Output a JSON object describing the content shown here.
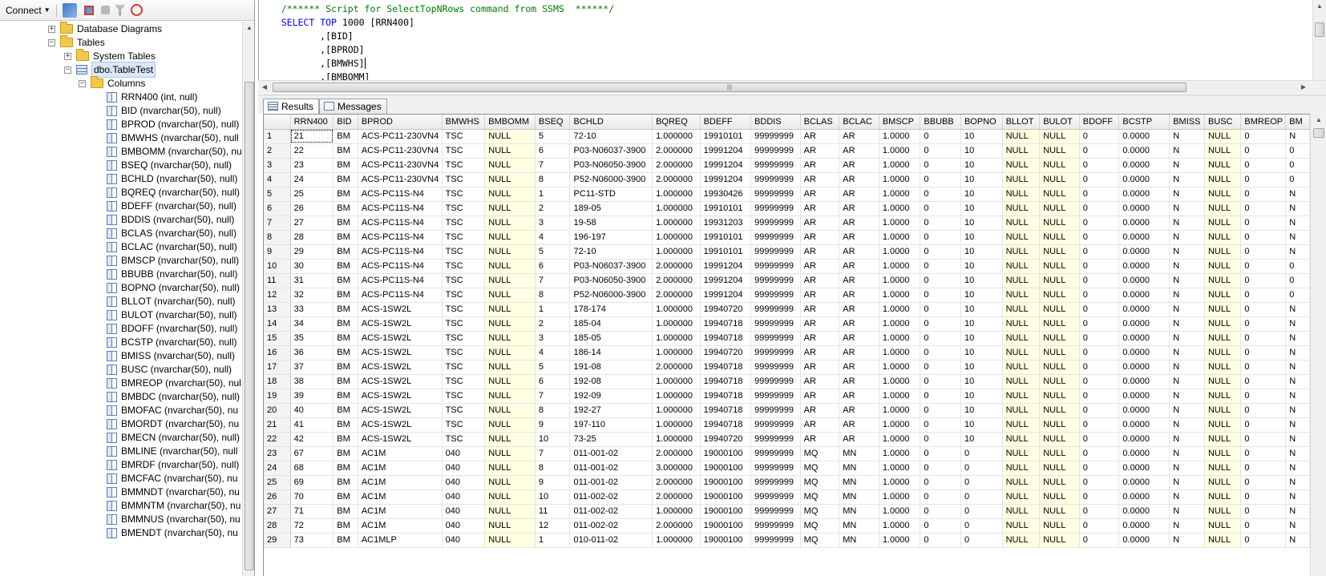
{
  "toolbar": {
    "connect_label": "Connect",
    "icons": [
      "connect-dropdown-icon",
      "connect-object-explorer-icon",
      "disconnect-icon",
      "stop-icon",
      "filter-icon",
      "refresh-icon"
    ]
  },
  "tree": {
    "nodes": [
      {
        "label": "Database Diagrams",
        "indent": 1,
        "icon": "folder"
      },
      {
        "label": "Tables",
        "indent": 1,
        "icon": "folder",
        "expanded": true
      },
      {
        "label": "System Tables",
        "indent": 2,
        "icon": "folder"
      },
      {
        "label": "dbo.TableTest",
        "indent": 2,
        "icon": "table",
        "expanded": true,
        "selected": true
      },
      {
        "label": "Columns",
        "indent": 3,
        "icon": "folder",
        "expanded": true
      }
    ],
    "columns": [
      "RRN400 (int, null)",
      "BID (nvarchar(50), null)",
      "BPROD (nvarchar(50), null)",
      "BMWHS (nvarchar(50), null",
      "BMBOMM (nvarchar(50), nu",
      "BSEQ (nvarchar(50), null)",
      "BCHLD (nvarchar(50), null)",
      "BQREQ (nvarchar(50), null)",
      "BDEFF (nvarchar(50), null)",
      "BDDIS (nvarchar(50), null)",
      "BCLAS (nvarchar(50), null)",
      "BCLAC (nvarchar(50), null)",
      "BMSCP (nvarchar(50), null)",
      "BBUBB (nvarchar(50), null)",
      "BOPNO (nvarchar(50), null)",
      "BLLOT (nvarchar(50), null)",
      "BULOT (nvarchar(50), null)",
      "BDOFF (nvarchar(50), null)",
      "BCSTP (nvarchar(50), null)",
      "BMISS (nvarchar(50), null)",
      "BUSC (nvarchar(50), null)",
      "BMREOP (nvarchar(50), nul",
      "BMBDC (nvarchar(50), null)",
      "BMOFAC (nvarchar(50), nu",
      "BMORDT (nvarchar(50), nu",
      "BMECN (nvarchar(50), null)",
      "BMLINE (nvarchar(50), null",
      "BMRDF (nvarchar(50), null)",
      "BMCFAC (nvarchar(50), nu",
      "BMMNDT (nvarchar(50), nu",
      "BMMNTM (nvarchar(50), nu",
      "BMMNUS (nvarchar(50), nu",
      "BMENDT (nvarchar(50), nu"
    ]
  },
  "editor": {
    "comment": "/****** Script for SelectTopNRows command from SSMS  ******/",
    "select_kw": "SELECT",
    "top_kw": "TOP",
    "top_n": "1000",
    "first_col": "[RRN400]",
    "lines": [
      ",[BID]",
      ",[BPROD]",
      ",[BMWHS]",
      ",[BMBOMM]"
    ]
  },
  "tabs": {
    "results": "Results",
    "messages": "Messages"
  },
  "grid": {
    "headers": [
      "RRN400",
      "BID",
      "BPROD",
      "BMWHS",
      "BMBOMM",
      "BSEQ",
      "BCHLD",
      "BQREQ",
      "BDEFF",
      "BDDIS",
      "BCLAS",
      "BCLAC",
      "BMSCP",
      "BBUBB",
      "BOPNO",
      "BLLOT",
      "BULOT",
      "BDOFF",
      "BCSTP",
      "BMISS",
      "BUSC",
      "BMREOP",
      "BM"
    ],
    "rows": [
      [
        "1",
        "21",
        "BM",
        "ACS-PC11-230VN4",
        "TSC",
        "NULL",
        "5",
        "72-10",
        "1.000000",
        "19910101",
        "99999999",
        "AR",
        "AR",
        "1.0000",
        "0",
        "10",
        "NULL",
        "NULL",
        "0",
        "0.0000",
        "N",
        "NULL",
        "0",
        "N"
      ],
      [
        "2",
        "22",
        "BM",
        "ACS-PC11-230VN4",
        "TSC",
        "NULL",
        "6",
        "P03-N06037-3900",
        "2.000000",
        "19991204",
        "99999999",
        "AR",
        "AR",
        "1.0000",
        "0",
        "10",
        "NULL",
        "NULL",
        "0",
        "0.0000",
        "N",
        "NULL",
        "0",
        "0"
      ],
      [
        "3",
        "23",
        "BM",
        "ACS-PC11-230VN4",
        "TSC",
        "NULL",
        "7",
        "P03-N06050-3900",
        "2.000000",
        "19991204",
        "99999999",
        "AR",
        "AR",
        "1.0000",
        "0",
        "10",
        "NULL",
        "NULL",
        "0",
        "0.0000",
        "N",
        "NULL",
        "0",
        "0"
      ],
      [
        "4",
        "24",
        "BM",
        "ACS-PC11-230VN4",
        "TSC",
        "NULL",
        "8",
        "P52-N06000-3900",
        "2.000000",
        "19991204",
        "99999999",
        "AR",
        "AR",
        "1.0000",
        "0",
        "10",
        "NULL",
        "NULL",
        "0",
        "0.0000",
        "N",
        "NULL",
        "0",
        "0"
      ],
      [
        "5",
        "25",
        "BM",
        "ACS-PC11S-N4",
        "TSC",
        "NULL",
        "1",
        "PC11-STD",
        "1.000000",
        "19930426",
        "99999999",
        "AR",
        "AR",
        "1.0000",
        "0",
        "10",
        "NULL",
        "NULL",
        "0",
        "0.0000",
        "N",
        "NULL",
        "0",
        "N"
      ],
      [
        "6",
        "26",
        "BM",
        "ACS-PC11S-N4",
        "TSC",
        "NULL",
        "2",
        "189-05",
        "1.000000",
        "19910101",
        "99999999",
        "AR",
        "AR",
        "1.0000",
        "0",
        "10",
        "NULL",
        "NULL",
        "0",
        "0.0000",
        "N",
        "NULL",
        "0",
        "N"
      ],
      [
        "7",
        "27",
        "BM",
        "ACS-PC11S-N4",
        "TSC",
        "NULL",
        "3",
        "19-58",
        "1.000000",
        "19931203",
        "99999999",
        "AR",
        "AR",
        "1.0000",
        "0",
        "10",
        "NULL",
        "NULL",
        "0",
        "0.0000",
        "N",
        "NULL",
        "0",
        "N"
      ],
      [
        "8",
        "28",
        "BM",
        "ACS-PC11S-N4",
        "TSC",
        "NULL",
        "4",
        "196-197",
        "1.000000",
        "19910101",
        "99999999",
        "AR",
        "AR",
        "1.0000",
        "0",
        "10",
        "NULL",
        "NULL",
        "0",
        "0.0000",
        "N",
        "NULL",
        "0",
        "N"
      ],
      [
        "9",
        "29",
        "BM",
        "ACS-PC11S-N4",
        "TSC",
        "NULL",
        "5",
        "72-10",
        "1.000000",
        "19910101",
        "99999999",
        "AR",
        "AR",
        "1.0000",
        "0",
        "10",
        "NULL",
        "NULL",
        "0",
        "0.0000",
        "N",
        "NULL",
        "0",
        "N"
      ],
      [
        "10",
        "30",
        "BM",
        "ACS-PC11S-N4",
        "TSC",
        "NULL",
        "6",
        "P03-N06037-3900",
        "2.000000",
        "19991204",
        "99999999",
        "AR",
        "AR",
        "1.0000",
        "0",
        "10",
        "NULL",
        "NULL",
        "0",
        "0.0000",
        "N",
        "NULL",
        "0",
        "0"
      ],
      [
        "11",
        "31",
        "BM",
        "ACS-PC11S-N4",
        "TSC",
        "NULL",
        "7",
        "P03-N06050-3900",
        "2.000000",
        "19991204",
        "99999999",
        "AR",
        "AR",
        "1.0000",
        "0",
        "10",
        "NULL",
        "NULL",
        "0",
        "0.0000",
        "N",
        "NULL",
        "0",
        "0"
      ],
      [
        "12",
        "32",
        "BM",
        "ACS-PC11S-N4",
        "TSC",
        "NULL",
        "8",
        "P52-N06000-3900",
        "2.000000",
        "19991204",
        "99999999",
        "AR",
        "AR",
        "1.0000",
        "0",
        "10",
        "NULL",
        "NULL",
        "0",
        "0.0000",
        "N",
        "NULL",
        "0",
        "0"
      ],
      [
        "13",
        "33",
        "BM",
        "ACS-1SW2L",
        "TSC",
        "NULL",
        "1",
        "178-174",
        "1.000000",
        "19940720",
        "99999999",
        "AR",
        "AR",
        "1.0000",
        "0",
        "10",
        "NULL",
        "NULL",
        "0",
        "0.0000",
        "N",
        "NULL",
        "0",
        "N"
      ],
      [
        "14",
        "34",
        "BM",
        "ACS-1SW2L",
        "TSC",
        "NULL",
        "2",
        "185-04",
        "1.000000",
        "19940718",
        "99999999",
        "AR",
        "AR",
        "1.0000",
        "0",
        "10",
        "NULL",
        "NULL",
        "0",
        "0.0000",
        "N",
        "NULL",
        "0",
        "N"
      ],
      [
        "15",
        "35",
        "BM",
        "ACS-1SW2L",
        "TSC",
        "NULL",
        "3",
        "185-05",
        "1.000000",
        "19940718",
        "99999999",
        "AR",
        "AR",
        "1.0000",
        "0",
        "10",
        "NULL",
        "NULL",
        "0",
        "0.0000",
        "N",
        "NULL",
        "0",
        "N"
      ],
      [
        "16",
        "36",
        "BM",
        "ACS-1SW2L",
        "TSC",
        "NULL",
        "4",
        "186-14",
        "1.000000",
        "19940720",
        "99999999",
        "AR",
        "AR",
        "1.0000",
        "0",
        "10",
        "NULL",
        "NULL",
        "0",
        "0.0000",
        "N",
        "NULL",
        "0",
        "N"
      ],
      [
        "17",
        "37",
        "BM",
        "ACS-1SW2L",
        "TSC",
        "NULL",
        "5",
        "191-08",
        "2.000000",
        "19940718",
        "99999999",
        "AR",
        "AR",
        "1.0000",
        "0",
        "10",
        "NULL",
        "NULL",
        "0",
        "0.0000",
        "N",
        "NULL",
        "0",
        "N"
      ],
      [
        "18",
        "38",
        "BM",
        "ACS-1SW2L",
        "TSC",
        "NULL",
        "6",
        "192-08",
        "1.000000",
        "19940718",
        "99999999",
        "AR",
        "AR",
        "1.0000",
        "0",
        "10",
        "NULL",
        "NULL",
        "0",
        "0.0000",
        "N",
        "NULL",
        "0",
        "N"
      ],
      [
        "19",
        "39",
        "BM",
        "ACS-1SW2L",
        "TSC",
        "NULL",
        "7",
        "192-09",
        "1.000000",
        "19940718",
        "99999999",
        "AR",
        "AR",
        "1.0000",
        "0",
        "10",
        "NULL",
        "NULL",
        "0",
        "0.0000",
        "N",
        "NULL",
        "0",
        "N"
      ],
      [
        "20",
        "40",
        "BM",
        "ACS-1SW2L",
        "TSC",
        "NULL",
        "8",
        "192-27",
        "1.000000",
        "19940718",
        "99999999",
        "AR",
        "AR",
        "1.0000",
        "0",
        "10",
        "NULL",
        "NULL",
        "0",
        "0.0000",
        "N",
        "NULL",
        "0",
        "N"
      ],
      [
        "21",
        "41",
        "BM",
        "ACS-1SW2L",
        "TSC",
        "NULL",
        "9",
        "197-110",
        "1.000000",
        "19940718",
        "99999999",
        "AR",
        "AR",
        "1.0000",
        "0",
        "10",
        "NULL",
        "NULL",
        "0",
        "0.0000",
        "N",
        "NULL",
        "0",
        "N"
      ],
      [
        "22",
        "42",
        "BM",
        "ACS-1SW2L",
        "TSC",
        "NULL",
        "10",
        "73-25",
        "1.000000",
        "19940720",
        "99999999",
        "AR",
        "AR",
        "1.0000",
        "0",
        "10",
        "NULL",
        "NULL",
        "0",
        "0.0000",
        "N",
        "NULL",
        "0",
        "N"
      ],
      [
        "23",
        "67",
        "BM",
        "AC1M",
        "040",
        "NULL",
        "7",
        "011-001-02",
        "2.000000",
        "19000100",
        "99999999",
        "MQ",
        "MN",
        "1.0000",
        "0",
        "0",
        "NULL",
        "NULL",
        "0",
        "0.0000",
        "N",
        "NULL",
        "0",
        "N"
      ],
      [
        "24",
        "68",
        "BM",
        "AC1M",
        "040",
        "NULL",
        "8",
        "011-001-02",
        "3.000000",
        "19000100",
        "99999999",
        "MQ",
        "MN",
        "1.0000",
        "0",
        "0",
        "NULL",
        "NULL",
        "0",
        "0.0000",
        "N",
        "NULL",
        "0",
        "N"
      ],
      [
        "25",
        "69",
        "BM",
        "AC1M",
        "040",
        "NULL",
        "9",
        "011-001-02",
        "2.000000",
        "19000100",
        "99999999",
        "MQ",
        "MN",
        "1.0000",
        "0",
        "0",
        "NULL",
        "NULL",
        "0",
        "0.0000",
        "N",
        "NULL",
        "0",
        "N"
      ],
      [
        "26",
        "70",
        "BM",
        "AC1M",
        "040",
        "NULL",
        "10",
        "011-002-02",
        "2.000000",
        "19000100",
        "99999999",
        "MQ",
        "MN",
        "1.0000",
        "0",
        "0",
        "NULL",
        "NULL",
        "0",
        "0.0000",
        "N",
        "NULL",
        "0",
        "N"
      ],
      [
        "27",
        "71",
        "BM",
        "AC1M",
        "040",
        "NULL",
        "11",
        "011-002-02",
        "1.000000",
        "19000100",
        "99999999",
        "MQ",
        "MN",
        "1.0000",
        "0",
        "0",
        "NULL",
        "NULL",
        "0",
        "0.0000",
        "N",
        "NULL",
        "0",
        "N"
      ],
      [
        "28",
        "72",
        "BM",
        "AC1M",
        "040",
        "NULL",
        "12",
        "011-002-02",
        "2.000000",
        "19000100",
        "99999999",
        "MQ",
        "MN",
        "1.0000",
        "0",
        "0",
        "NULL",
        "NULL",
        "0",
        "0.0000",
        "N",
        "NULL",
        "0",
        "N"
      ],
      [
        "29",
        "73",
        "BM",
        "AC1MLP",
        "040",
        "NULL",
        "1",
        "010-011-02",
        "1.000000",
        "19000100",
        "99999999",
        "MQ",
        "MN",
        "1.0000",
        "0",
        "0",
        "NULL",
        "NULL",
        "0",
        "0.0000",
        "N",
        "NULL",
        "0",
        "N"
      ]
    ]
  }
}
